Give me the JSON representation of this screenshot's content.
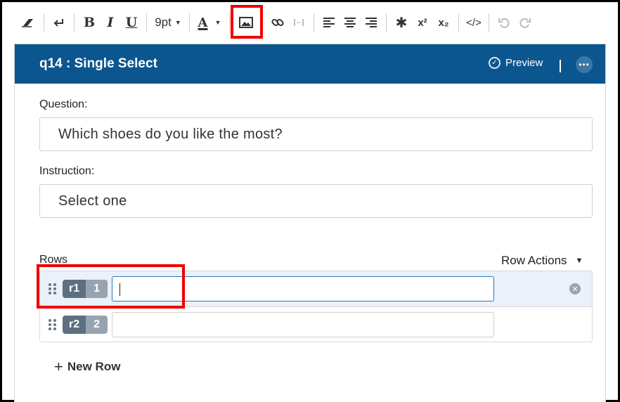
{
  "toolbar": {
    "font_size": "9pt",
    "font_color_letter": "A",
    "bold": "B",
    "italic": "I",
    "underline": "U",
    "asterisk": "✱",
    "superscript": "x²",
    "subscript": "x₂",
    "code": "</>"
  },
  "card": {
    "title": "q14 : Single Select",
    "preview_label": "Preview"
  },
  "question": {
    "label": "Question:",
    "value": "Which shoes do you like the most?"
  },
  "instruction": {
    "label": "Instruction:",
    "value": "Select one"
  },
  "rows": {
    "label": "Rows",
    "actions_label": "Row Actions",
    "items": [
      {
        "code": "r1",
        "num": "1",
        "value": ""
      },
      {
        "code": "r2",
        "num": "2",
        "value": ""
      }
    ],
    "new_row_label": "New Row"
  },
  "colors": {
    "header": "#0b568f",
    "highlight": "#ee0000",
    "active_row": "#eaf1f8"
  }
}
